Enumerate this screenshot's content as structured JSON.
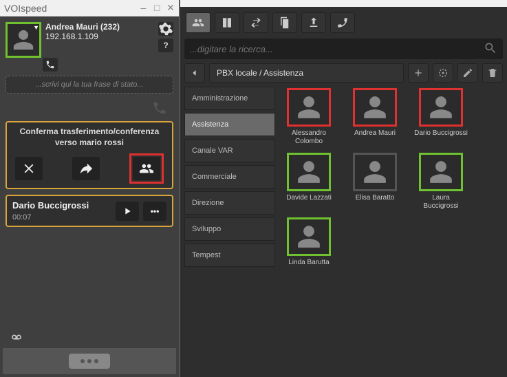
{
  "window": {
    "title": "VOIspeed",
    "minimize": "–",
    "maximize": "□",
    "close": "✕"
  },
  "user": {
    "name": "Andrea Mauri (232)",
    "ip": "192.168.1.109"
  },
  "status_placeholder": "...scrivi qui la tua frase di stato...",
  "transfer": {
    "line1": "Conferma trasferimento/conferenza",
    "line2": "verso mario rossi"
  },
  "active_call": {
    "caller": "Dario Buccigrossi",
    "timer": "00:07"
  },
  "search": {
    "placeholder": "...digitare la ricerca..."
  },
  "breadcrumb": "PBX locale / Assistenza",
  "groups": [
    {
      "label": "Amministrazione",
      "selected": false
    },
    {
      "label": "Assistenza",
      "selected": true
    },
    {
      "label": "Canale VAR",
      "selected": false
    },
    {
      "label": "Commerciale",
      "selected": false
    },
    {
      "label": "Direzione",
      "selected": false
    },
    {
      "label": "Sviluppo",
      "selected": false
    },
    {
      "label": "Tempest",
      "selected": false
    }
  ],
  "contacts": [
    {
      "name": "Alessandro Colombo",
      "status": "busy"
    },
    {
      "name": "Andrea Mauri",
      "status": "busy"
    },
    {
      "name": "Dario Buccigrossi",
      "status": "busy"
    },
    {
      "name": "Davide Lazzati",
      "status": "online"
    },
    {
      "name": "Elisa Baratto",
      "status": "away"
    },
    {
      "name": "Laura Buccigrossi",
      "status": "online"
    },
    {
      "name": "Linda Barutta",
      "status": "online"
    }
  ],
  "icons": {
    "settings": "gear-icon",
    "help": "help-icon",
    "phone": "phone-icon",
    "cancel": "cancel-icon",
    "forward": "forward-icon",
    "people": "people-icon",
    "play": "play-icon",
    "more": "more-icon",
    "voicemail": "voicemail-icon",
    "search": "search-icon",
    "add": "plus-icon",
    "target": "target-icon",
    "edit": "pencil-icon",
    "delete": "trash-icon",
    "back": "back-icon",
    "contacts": "contacts-icon",
    "book": "book-icon",
    "transfer": "transfer-icon",
    "copy": "copy-icon",
    "export": "export-icon",
    "redial": "redial-icon"
  }
}
